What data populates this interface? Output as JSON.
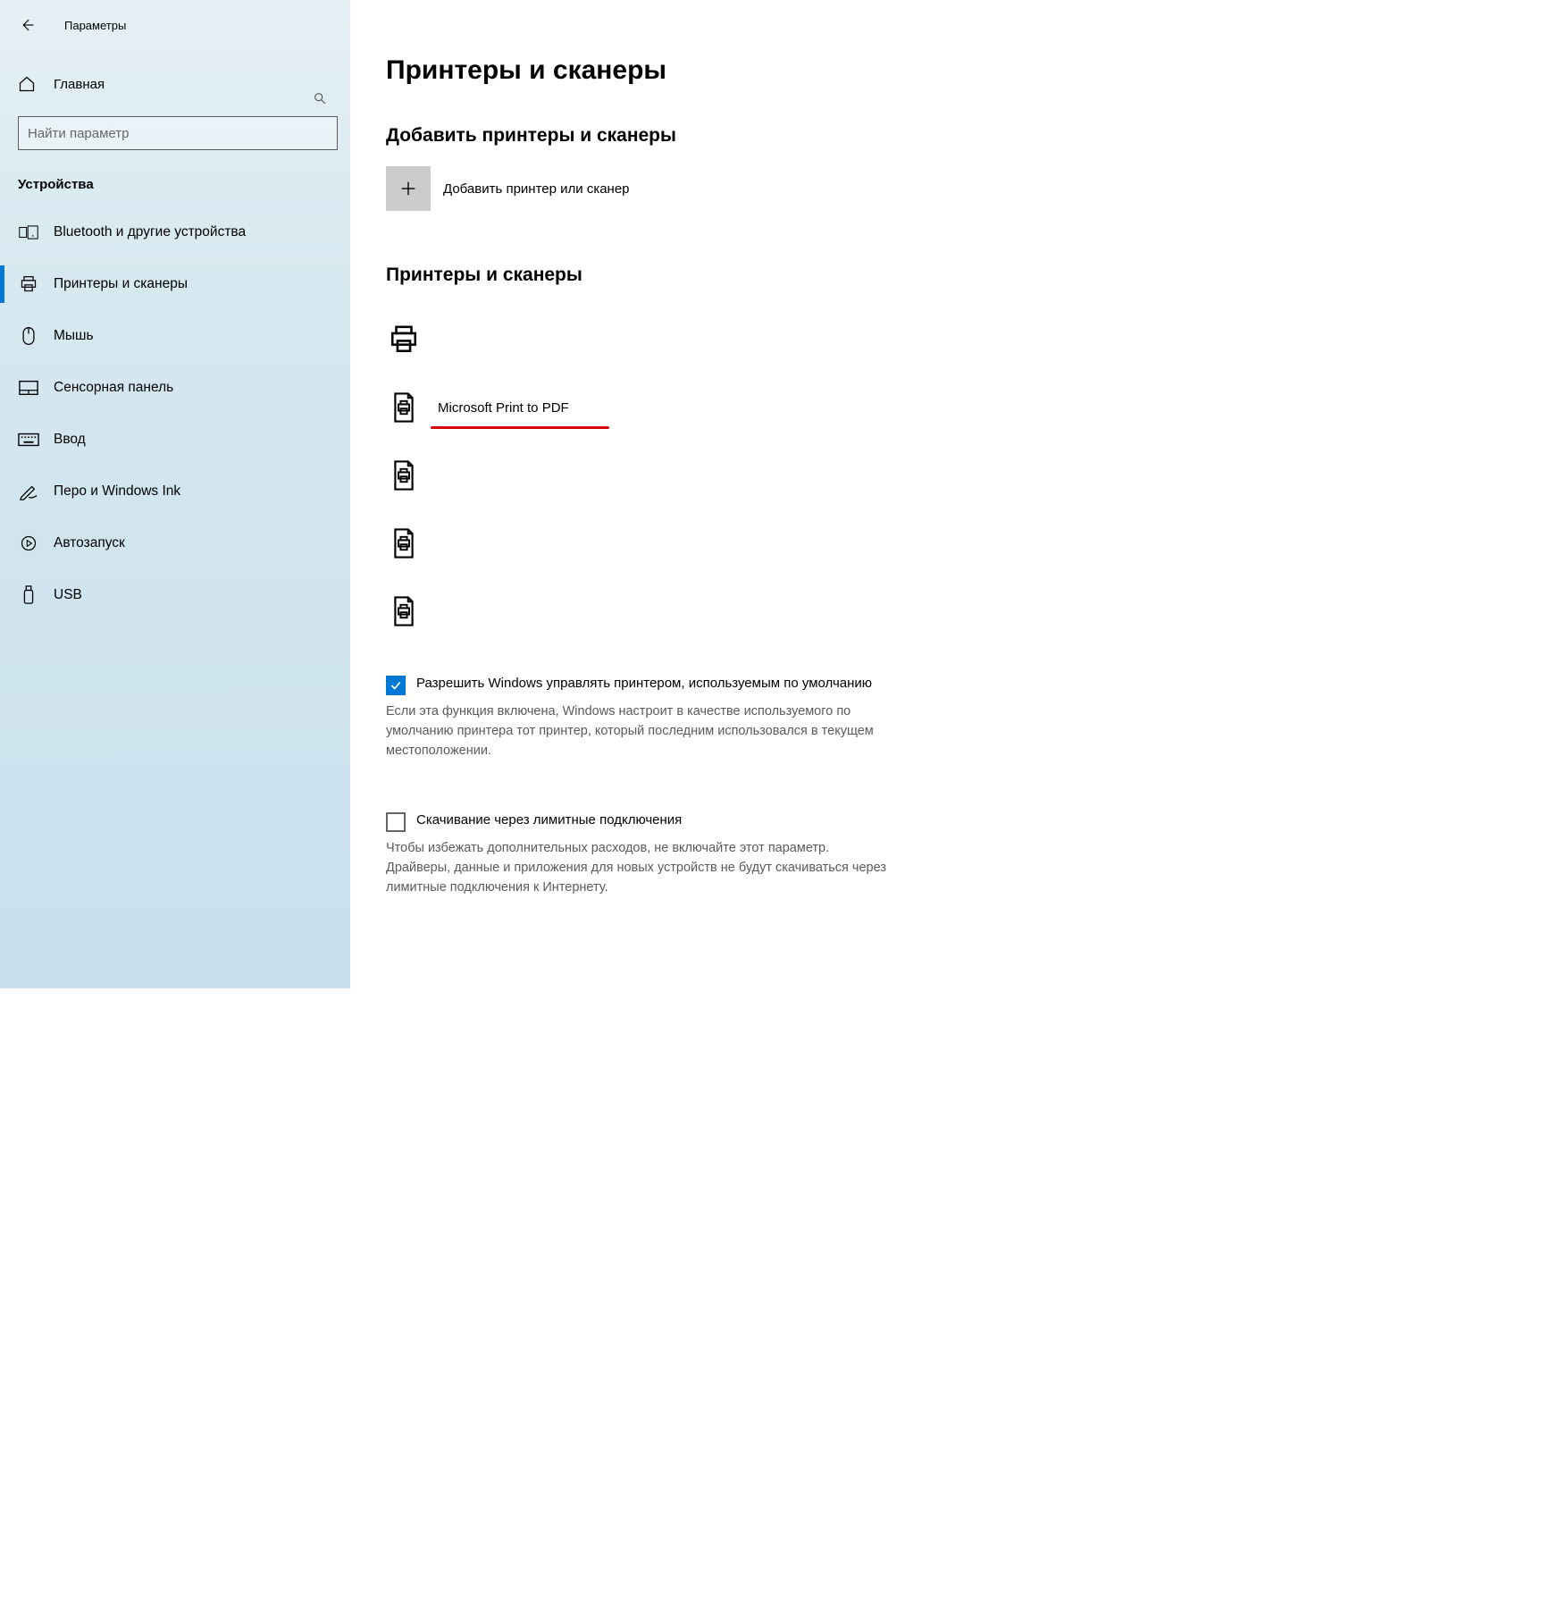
{
  "header": {
    "title": "Параметры"
  },
  "sidebar": {
    "home": "Главная",
    "search_placeholder": "Найти параметр",
    "category": "Устройства",
    "items": [
      {
        "label": "Bluetooth и другие устройства",
        "icon": "bluetooth-devices-icon"
      },
      {
        "label": "Принтеры и сканеры",
        "icon": "printer-icon"
      },
      {
        "label": "Мышь",
        "icon": "mouse-icon"
      },
      {
        "label": "Сенсорная панель",
        "icon": "touchpad-icon"
      },
      {
        "label": "Ввод",
        "icon": "keyboard-icon"
      },
      {
        "label": "Перо и Windows Ink",
        "icon": "pen-icon"
      },
      {
        "label": "Автозапуск",
        "icon": "autoplay-icon"
      },
      {
        "label": "USB",
        "icon": "usb-icon"
      }
    ]
  },
  "main": {
    "page_title": "Принтеры и сканеры",
    "add_section_title": "Добавить принтеры и сканеры",
    "add_label": "Добавить принтер или сканер",
    "list_section_title": "Принтеры и сканеры",
    "devices": [
      {
        "label": ""
      },
      {
        "label": "Microsoft Print to PDF",
        "underline": true
      },
      {
        "label": ""
      },
      {
        "label": ""
      },
      {
        "label": ""
      }
    ],
    "checkbox1_label": "Разрешить Windows управлять принтером, используемым по умолчанию",
    "checkbox1_help": "Если эта функция включена, Windows настроит в качестве используемого по умолчанию принтера тот принтер, который последним использовался в текущем местоположении.",
    "checkbox2_label": "Скачивание через лимитные подключения",
    "checkbox2_help": "Чтобы избежать дополнительных расходов, не включайте этот параметр. Драйверы, данные и приложения для новых устройств не будут скачиваться через лимитные подключения к Интернету."
  }
}
